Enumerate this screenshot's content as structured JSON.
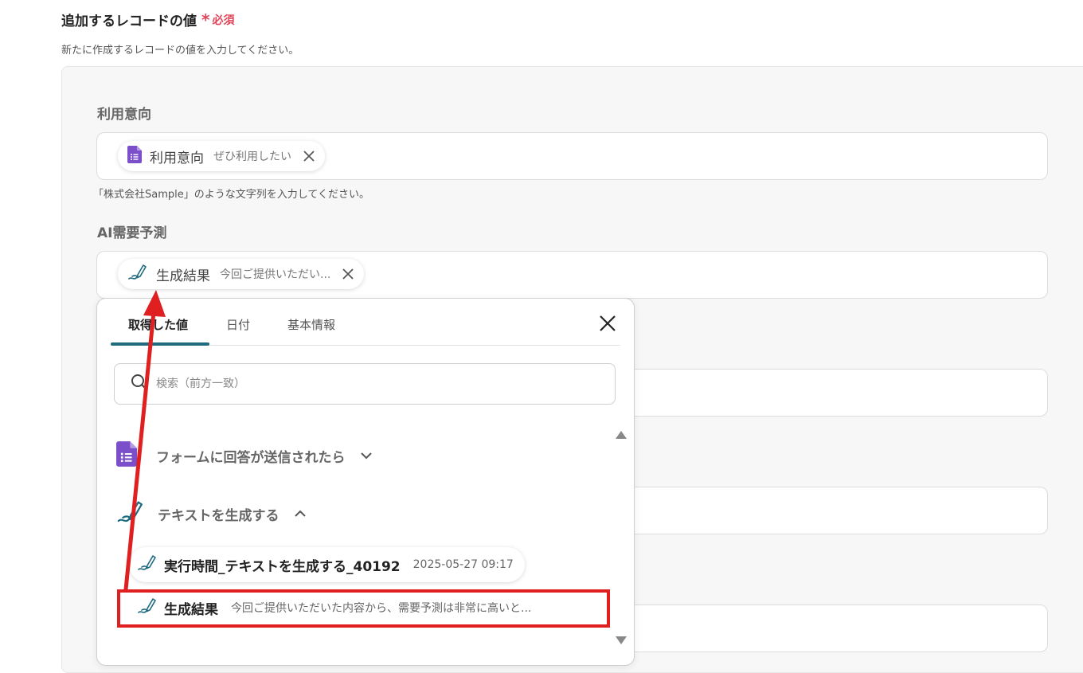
{
  "header": {
    "title": "追加するレコードの値",
    "required_star": "*",
    "required_label": "必須",
    "description": "新たに作成するレコードの値を入力してください。"
  },
  "fields": {
    "f1": {
      "label": "利用意向",
      "pill_name": "利用意向",
      "pill_value": "ぜひ利用したい",
      "pill_icon": "google-forms-icon",
      "hint": "「株式会社Sample」のような文字列を入力してください。"
    },
    "f2": {
      "label": "AI需要予測",
      "pill_name": "生成結果",
      "pill_value": "今回ご提供いただい...",
      "pill_icon": "ai-pen-icon"
    }
  },
  "popup": {
    "tabs": [
      "取得した値",
      "日付",
      "基本情報"
    ],
    "active_tab": "取得した値",
    "search_placeholder": "検索（前方一致）",
    "groups": {
      "g1": {
        "label": "フォームに回答が送信されたら",
        "icon": "google-forms-icon",
        "expanded": false
      },
      "g2": {
        "label": "テキストを生成する",
        "icon": "ai-pen-icon",
        "expanded": true
      }
    },
    "items": {
      "i1": {
        "name": "実行時間_テキストを生成する_40192",
        "value": "2025-05-27 09:17"
      },
      "i2": {
        "name": "生成結果",
        "value": "今回ご提供いただいた内容から、需要予測は非常に高いと..."
      }
    }
  },
  "colors": {
    "required": "#e0455a",
    "tab_underline": "#1e6b80",
    "annotation_red": "#e02020",
    "forms_purple": "#7b4fc9"
  }
}
